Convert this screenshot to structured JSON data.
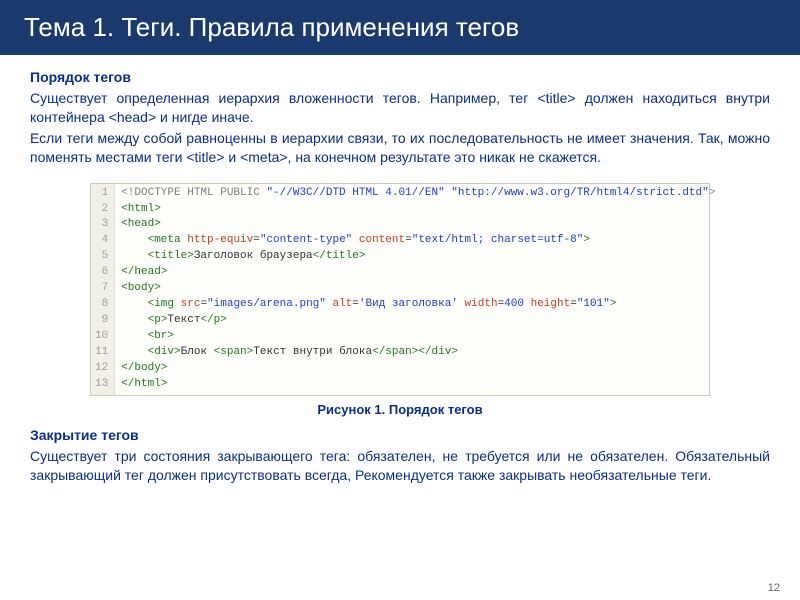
{
  "title": "Тема 1. Теги. Правила применения тегов",
  "section1": {
    "heading": "Порядок тегов",
    "p1": "Существует определенная иерархия вложенности тегов. Например, тег <title> должен находиться внутри контейнера <head> и нигде иначе.",
    "p2": "Если теги между собой равноценны в иерархии связи, то их последовательность не имеет значения. Так, можно поменять местами теги <title> и <meta>, на конечном результате это никак не скажется."
  },
  "code": {
    "lines": [
      {
        "n": "1",
        "indent": 0,
        "raw": "<!DOCTYPE HTML PUBLIC \"-//W3C//DTD HTML 4.01//EN\" \"http://www.w3.org/TR/html4/strict.dtd\">"
      },
      {
        "n": "2",
        "indent": 0,
        "raw": "<html>"
      },
      {
        "n": "3",
        "indent": 0,
        "raw": "<head>"
      },
      {
        "n": "4",
        "indent": 1,
        "raw": "<meta http-equiv=\"content-type\" content=\"text/html; charset=utf-8\">"
      },
      {
        "n": "5",
        "indent": 1,
        "raw": "<title>Заголовок браузера</title>"
      },
      {
        "n": "6",
        "indent": 0,
        "raw": "</head>"
      },
      {
        "n": "7",
        "indent": 0,
        "raw": "<body>"
      },
      {
        "n": "8",
        "indent": 1,
        "raw": "<img src=\"images/arena.png\" alt='Вид заголовка' width=400 height=\"101\">"
      },
      {
        "n": "9",
        "indent": 1,
        "raw": "<p>Текст</p>"
      },
      {
        "n": "10",
        "indent": 1,
        "raw": "<br>"
      },
      {
        "n": "11",
        "indent": 1,
        "raw": "<div>Блок <span>Текст внутри блока</span></div>"
      },
      {
        "n": "12",
        "indent": 0,
        "raw": "</body>"
      },
      {
        "n": "13",
        "indent": 0,
        "raw": "</html>"
      }
    ]
  },
  "caption": "Рисунок 1. Порядок тегов",
  "section2": {
    "heading": "Закрытие тегов",
    "p1": "Существует три состояния закрывающего тега: обязателен, не требуется или не обязателен. Обязательный закрывающий тег должен присутствовать всегда, Рекомендуется также закрывать необязательные теги."
  },
  "pagenum": "12"
}
